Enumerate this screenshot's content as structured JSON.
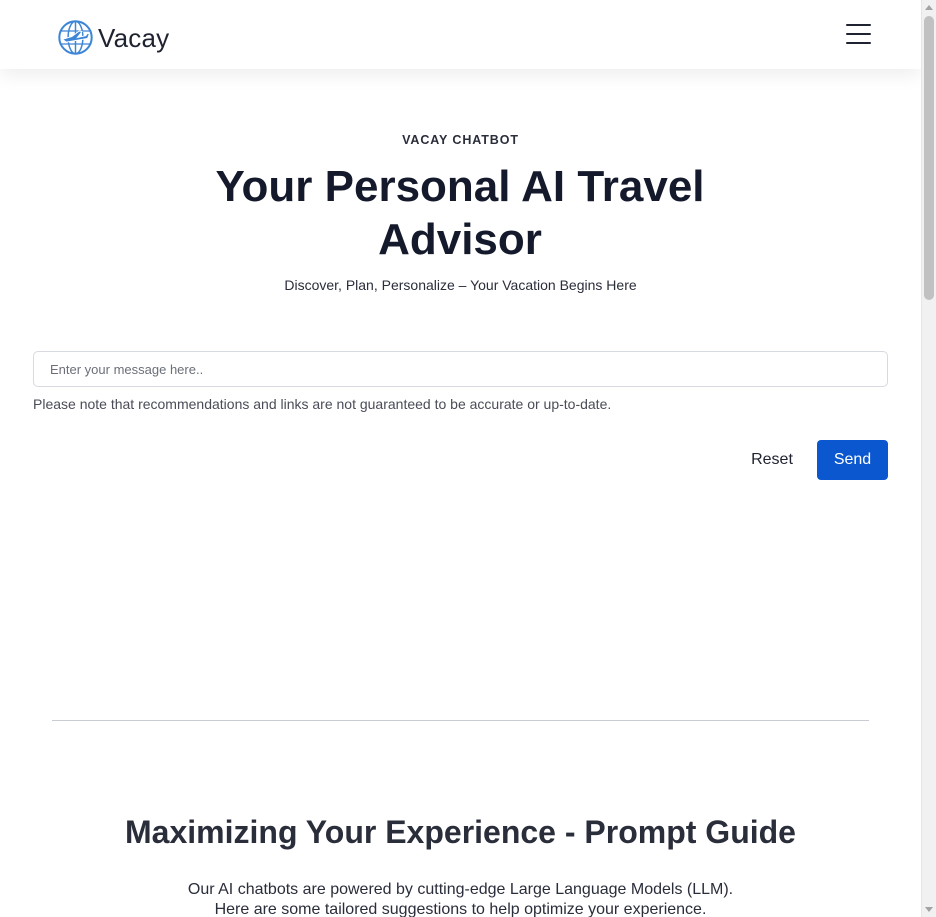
{
  "header": {
    "brand_name": "Vacay",
    "logo_icon": "globe-airplane-icon",
    "menu_icon": "hamburger-menu-icon"
  },
  "hero": {
    "eyebrow": "VACAY CHATBOT",
    "title": "Your Personal AI Travel Advisor",
    "subtitle": "Discover, Plan, Personalize – Your Vacation Begins Here"
  },
  "chat": {
    "input_value": "",
    "input_placeholder": "Enter your message here..",
    "disclaimer": "Please note that recommendations and links are not guaranteed to be accurate or up-to-date.",
    "reset_label": "Reset",
    "send_label": "Send"
  },
  "guide": {
    "title": "Maximizing Your Experience - Prompt Guide",
    "intro_line1": "Our AI chatbots are powered by cutting-edge Large Language Models (LLM).",
    "intro_line2": "Here are some tailored suggestions to help optimize your experience."
  },
  "colors": {
    "accent": "#0b57d0",
    "logo_blue": "#3d85d6",
    "heading": "#141a2b",
    "divider": "#c9ccd2"
  }
}
